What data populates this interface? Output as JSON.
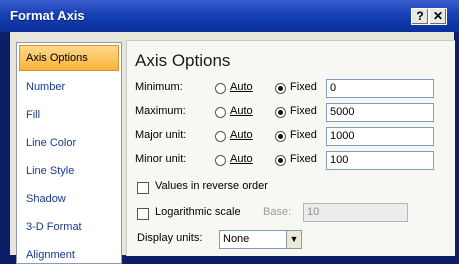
{
  "window": {
    "title": "Format Axis",
    "help_label": "?",
    "close_label": "✕"
  },
  "sidebar": {
    "items": [
      {
        "label": "Axis Options",
        "active": true
      },
      {
        "label": "Number"
      },
      {
        "label": "Fill"
      },
      {
        "label": "Line Color"
      },
      {
        "label": "Line Style"
      },
      {
        "label": "Shadow"
      },
      {
        "label": "3-D Format"
      },
      {
        "label": "Alignment"
      }
    ]
  },
  "panel": {
    "title": "Axis Options",
    "rows": [
      {
        "label": "Minimum:",
        "auto_label": "Auto",
        "fixed_label": "Fixed",
        "value": "0"
      },
      {
        "label": "Maximum:",
        "auto_label": "Auto",
        "fixed_label": "Fixed",
        "value": "5000"
      },
      {
        "label": "Major unit:",
        "auto_label": "Auto",
        "fixed_label": "Fixed",
        "value": "1000"
      },
      {
        "label": "Minor unit:",
        "auto_label": "Auto",
        "fixed_label": "Fixed",
        "value": "100"
      }
    ],
    "reverse_order_label": "Values in reverse order",
    "log_scale_label": "Logarithmic scale",
    "base_label": "Base:",
    "base_value": "10",
    "display_units_label": "Display units:",
    "display_units_value": "None"
  }
}
